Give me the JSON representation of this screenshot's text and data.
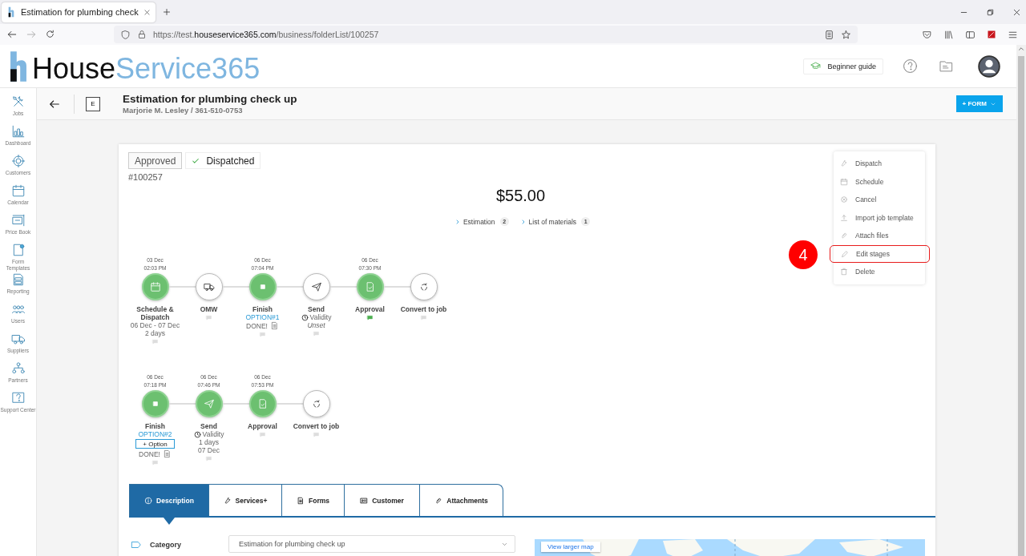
{
  "browser": {
    "tab_title": "Estimation for plumbing check",
    "url": {
      "prefix": "https://test.",
      "host": "houseservice365.com",
      "path": "/business/folderList/100257"
    }
  },
  "header": {
    "logo": {
      "dark": "House",
      "light": "Service365"
    },
    "guide_button": "Beginner guide"
  },
  "sidebar": {
    "items": [
      {
        "label": "Jobs",
        "kind": "tools"
      },
      {
        "label": "Dashboard",
        "kind": "chart"
      },
      {
        "label": "Customers",
        "kind": "target"
      },
      {
        "label": "Calendar",
        "kind": "calendar"
      },
      {
        "label": "Price Book",
        "kind": "price"
      },
      {
        "label": "Form Templates",
        "kind": "form"
      },
      {
        "label": "Reporting",
        "kind": "report"
      },
      {
        "label": "Users",
        "kind": "users"
      },
      {
        "label": "Suppliers",
        "kind": "truck"
      },
      {
        "label": "Partners",
        "kind": "partners"
      },
      {
        "label": "Support Center",
        "kind": "help"
      }
    ]
  },
  "titlebar": {
    "badge": "E",
    "title": "Estimation for plumbing check up",
    "subtitle": "Marjorie M. Lesley / 361-510-0753",
    "form_button": "+ FORM"
  },
  "job": {
    "statuses": [
      {
        "label": "Approved",
        "checked": false
      },
      {
        "label": "Dispatched",
        "checked": true
      }
    ],
    "number": "#100257",
    "price": "$55.00",
    "links": [
      {
        "label": "Estimation",
        "count": "2"
      },
      {
        "label": "List of materials",
        "count": "1"
      }
    ],
    "stage_rows": [
      [
        {
          "date": "03 Dec",
          "time": "02:03 PM",
          "label": "Schedule & Dispatch",
          "done": true,
          "kind": "calendar",
          "lines": [
            {
              "kind": "text",
              "text": "06 Dec - 07 Dec"
            },
            {
              "kind": "text",
              "text": "2 days"
            }
          ],
          "comment_active": false
        },
        {
          "label": "OMW",
          "done": false,
          "kind": "truck",
          "comment_active": false
        },
        {
          "date": "06 Dec",
          "time": "07:04 PM",
          "label": "Finish",
          "done": true,
          "kind": "square",
          "lines": [
            {
              "kind": "option",
              "text": "OPTION#1"
            },
            {
              "kind": "done",
              "text": "DONE!"
            }
          ],
          "comment_active": false
        },
        {
          "label": "Send",
          "done": false,
          "kind": "plane",
          "lines": [
            {
              "kind": "validity",
              "text": "Validity"
            },
            {
              "kind": "italic",
              "text": "Unset"
            }
          ],
          "comment_active": false
        },
        {
          "date": "06 Dec",
          "time": "07:30 PM",
          "label": "Approval",
          "done": true,
          "kind": "doc",
          "comment_active": true
        },
        {
          "label": "Convert to job",
          "done": false,
          "kind": "recycle",
          "comment_active": false
        }
      ],
      [
        {
          "date": "06 Dec",
          "time": "07:18 PM",
          "label": "Finish",
          "done": true,
          "kind": "square",
          "lines": [
            {
              "kind": "option",
              "text": "OPTION#2"
            },
            {
              "kind": "button",
              "text": "+ Option"
            },
            {
              "kind": "done",
              "text": "DONE!"
            }
          ],
          "comment_active": false
        },
        {
          "date": "06 Dec",
          "time": "07:46 PM",
          "label": "Send",
          "done": true,
          "kind": "plane",
          "lines": [
            {
              "kind": "validity",
              "text": "Validity"
            },
            {
              "kind": "text",
              "text": "1 days"
            },
            {
              "kind": "text",
              "text": "07 Dec"
            }
          ],
          "comment_active": false
        },
        {
          "date": "06 Dec",
          "time": "07:53 PM",
          "label": "Approval",
          "done": true,
          "kind": "doc",
          "comment_active": false
        },
        {
          "label": "Convert to job",
          "done": false,
          "kind": "recycle",
          "comment_active": false
        }
      ]
    ]
  },
  "actions_menu": {
    "items": [
      {
        "label": "Dispatch",
        "kind": "wrench",
        "highlighted": false
      },
      {
        "label": "Schedule",
        "kind": "calendar",
        "highlighted": false
      },
      {
        "label": "Cancel",
        "kind": "cancel",
        "highlighted": false
      },
      {
        "label": "Import job template",
        "kind": "upload",
        "highlighted": false
      },
      {
        "label": "Attach files",
        "kind": "clip",
        "highlighted": false
      },
      {
        "label": "Edit stages",
        "kind": "pencil",
        "highlighted": true
      },
      {
        "label": "Delete",
        "kind": "trash",
        "highlighted": false
      }
    ]
  },
  "annotation": {
    "number": "4"
  },
  "tabs": [
    {
      "label": "Description",
      "kind": "info",
      "selected": true
    },
    {
      "label": "Services+",
      "kind": "wrench",
      "selected": false
    },
    {
      "label": "Forms",
      "kind": "file",
      "selected": false
    },
    {
      "label": "Customer",
      "kind": "idcard",
      "selected": false
    },
    {
      "label": "Attachments",
      "kind": "clip",
      "selected": false
    }
  ],
  "details": {
    "category_label": "Category",
    "category_value": "Estimation for plumbing check up",
    "map_button": "View larger map"
  }
}
